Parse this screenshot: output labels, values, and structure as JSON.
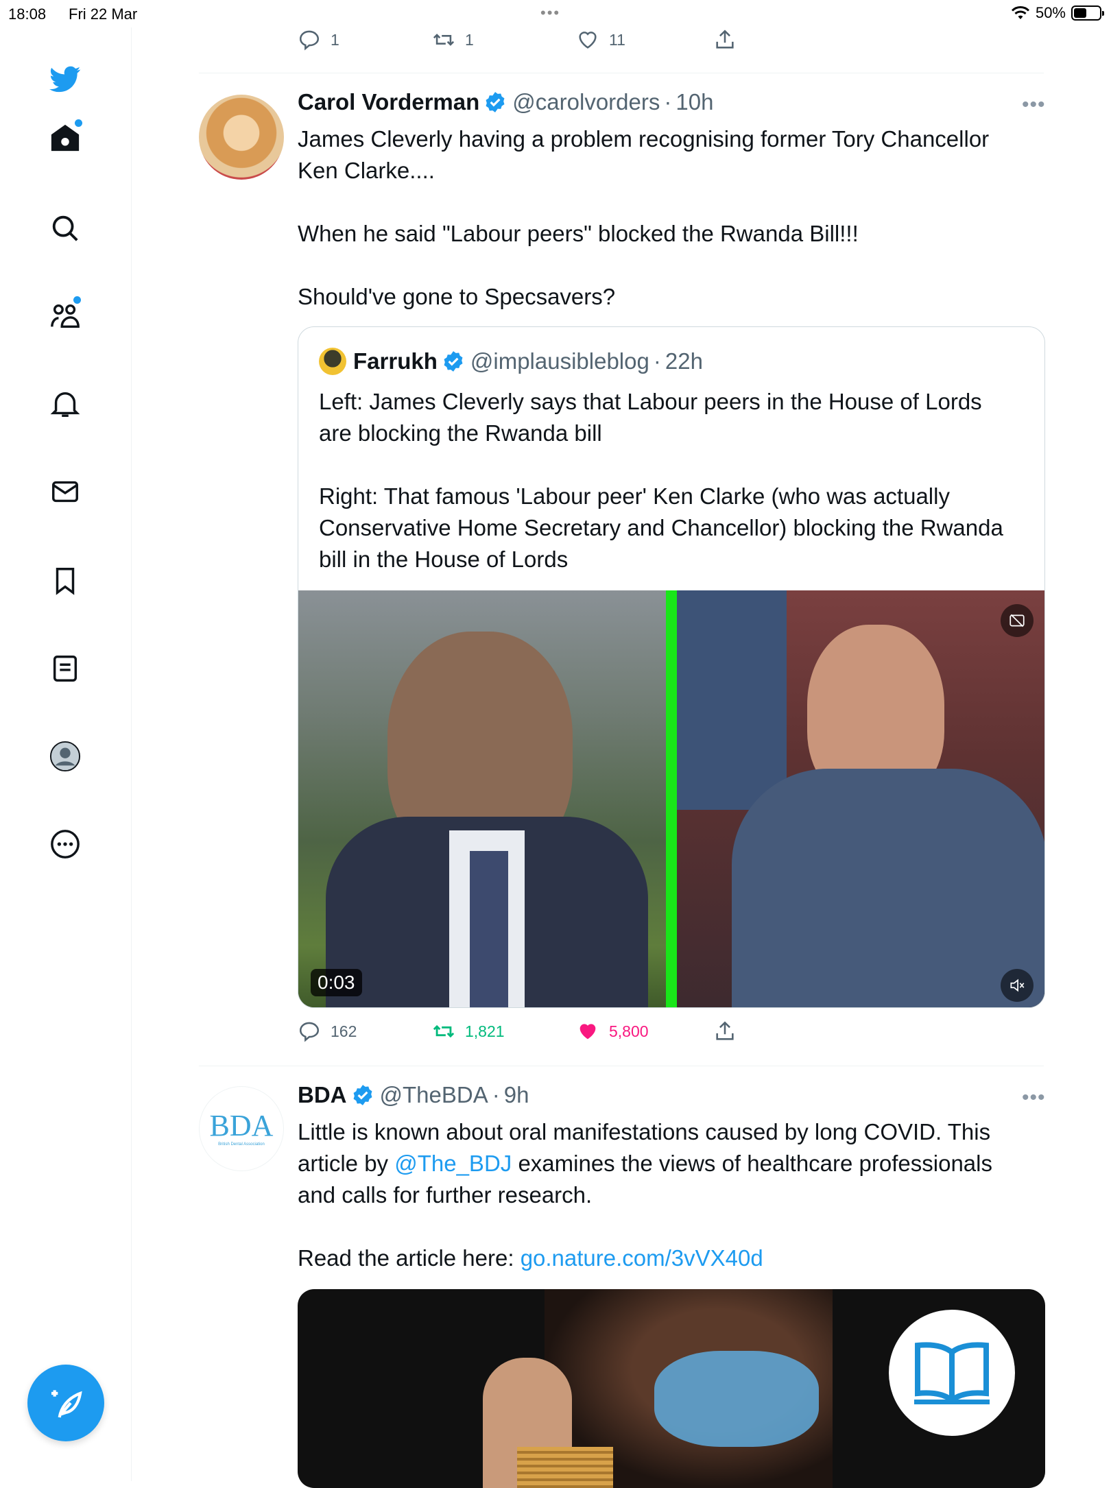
{
  "status_bar": {
    "time": "18:08",
    "date": "Fri 22 Mar",
    "battery_percent": "50%",
    "battery_level": 0.5
  },
  "sidebar": {
    "items": [
      {
        "icon": "twitter-logo-icon"
      },
      {
        "icon": "home-icon",
        "unread": true
      },
      {
        "icon": "search-icon"
      },
      {
        "icon": "communities-icon",
        "unread": true
      },
      {
        "icon": "notifications-bell-icon"
      },
      {
        "icon": "messages-envelope-icon"
      },
      {
        "icon": "bookmark-icon"
      },
      {
        "icon": "lists-icon"
      },
      {
        "icon": "profile-avatar-icon"
      },
      {
        "icon": "more-circle-icon"
      }
    ],
    "compose_icon": "compose-feather-icon"
  },
  "previous_tweet": {
    "actions": {
      "replies": "1",
      "retweets": "1",
      "likes": "11"
    }
  },
  "tweets": [
    {
      "name": "Carol Vorderman",
      "handle": "@carolvorders",
      "time": "10h",
      "text": "James Cleverly having a problem recognising former Tory Chancellor\nKen Clarke....\n\nWhen he said \"Labour peers\" blocked the Rwanda Bill!!!\n\nShould've gone to Specsavers?",
      "quote": {
        "name": "Farrukh",
        "handle": "@implausibleblog",
        "time": "22h",
        "text": "Left: James Cleverly says that Labour peers in the House of Lords\nare blocking the Rwanda bill\n\nRight: That famous 'Labour peer' Ken Clarke (who was actually\nConservative Home Secretary and Chancellor) blocking the Rwanda\nbill in the House of Lords",
        "video_duration": "0:03"
      },
      "actions": {
        "replies": "162",
        "retweets": "1,821",
        "likes": "5,800"
      }
    },
    {
      "name": "BDA",
      "handle": "@TheBDA",
      "time": "9h",
      "avatar_text": "BDA",
      "avatar_subtext": "British Dental Association",
      "text_before_mention": "Little is known about oral manifestations caused by long COVID. This\narticle by ",
      "mention": "@The_BDJ",
      "text_after_mention": " examines the views of healthcare professionals\nand calls for further research.",
      "read_label": "Read the article here: ",
      "link": "go.nature.com/3vVX40d"
    }
  ],
  "colors": {
    "accent": "#1d9bf0",
    "retweet_active": "#00ba7c",
    "like_active": "#f91880",
    "secondary_text": "#536471"
  }
}
